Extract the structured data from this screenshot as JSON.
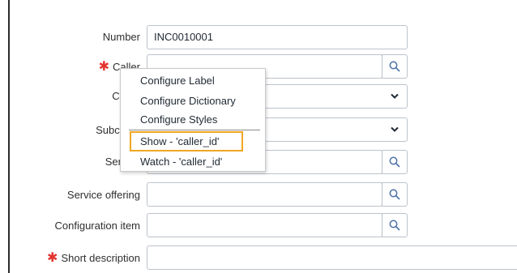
{
  "form": {
    "number": {
      "label": "Number",
      "value": "INC0010001"
    },
    "caller": {
      "label": "Caller",
      "required_mark": "✱"
    },
    "category": {
      "label": "Categ"
    },
    "subcategory": {
      "label": "Subcateg"
    },
    "service": {
      "label": "Ser"
    },
    "service_offering": {
      "label": "Service offering"
    },
    "configuration_item": {
      "label": "Configuration item"
    },
    "short_description": {
      "label": "Short description",
      "required_mark": "✱"
    }
  },
  "context_menu": {
    "items": [
      {
        "label": "Configure Label"
      },
      {
        "label": "Configure Dictionary"
      },
      {
        "label": "Configure Styles"
      },
      {
        "label": "Show - 'caller_id'"
      },
      {
        "label": "Watch - 'caller_id'"
      }
    ]
  },
  "colors": {
    "required": "#e3342f",
    "highlight": "#f0a623",
    "icon": "#4a6fa5"
  },
  "icons": {
    "lookup": "search-icon",
    "select": "chevron-down-icon"
  }
}
